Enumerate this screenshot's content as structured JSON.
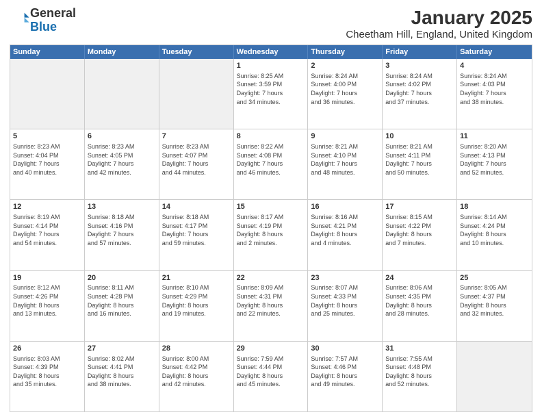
{
  "logo": {
    "general": "General",
    "blue": "Blue"
  },
  "title": "January 2025",
  "subtitle": "Cheetham Hill, England, United Kingdom",
  "days": [
    "Sunday",
    "Monday",
    "Tuesday",
    "Wednesday",
    "Thursday",
    "Friday",
    "Saturday"
  ],
  "weeks": [
    [
      {
        "day": "",
        "info": ""
      },
      {
        "day": "",
        "info": ""
      },
      {
        "day": "",
        "info": ""
      },
      {
        "day": "1",
        "info": "Sunrise: 8:25 AM\nSunset: 3:59 PM\nDaylight: 7 hours\nand 34 minutes."
      },
      {
        "day": "2",
        "info": "Sunrise: 8:24 AM\nSunset: 4:00 PM\nDaylight: 7 hours\nand 36 minutes."
      },
      {
        "day": "3",
        "info": "Sunrise: 8:24 AM\nSunset: 4:02 PM\nDaylight: 7 hours\nand 37 minutes."
      },
      {
        "day": "4",
        "info": "Sunrise: 8:24 AM\nSunset: 4:03 PM\nDaylight: 7 hours\nand 38 minutes."
      }
    ],
    [
      {
        "day": "5",
        "info": "Sunrise: 8:23 AM\nSunset: 4:04 PM\nDaylight: 7 hours\nand 40 minutes."
      },
      {
        "day": "6",
        "info": "Sunrise: 8:23 AM\nSunset: 4:05 PM\nDaylight: 7 hours\nand 42 minutes."
      },
      {
        "day": "7",
        "info": "Sunrise: 8:23 AM\nSunset: 4:07 PM\nDaylight: 7 hours\nand 44 minutes."
      },
      {
        "day": "8",
        "info": "Sunrise: 8:22 AM\nSunset: 4:08 PM\nDaylight: 7 hours\nand 46 minutes."
      },
      {
        "day": "9",
        "info": "Sunrise: 8:21 AM\nSunset: 4:10 PM\nDaylight: 7 hours\nand 48 minutes."
      },
      {
        "day": "10",
        "info": "Sunrise: 8:21 AM\nSunset: 4:11 PM\nDaylight: 7 hours\nand 50 minutes."
      },
      {
        "day": "11",
        "info": "Sunrise: 8:20 AM\nSunset: 4:13 PM\nDaylight: 7 hours\nand 52 minutes."
      }
    ],
    [
      {
        "day": "12",
        "info": "Sunrise: 8:19 AM\nSunset: 4:14 PM\nDaylight: 7 hours\nand 54 minutes."
      },
      {
        "day": "13",
        "info": "Sunrise: 8:18 AM\nSunset: 4:16 PM\nDaylight: 7 hours\nand 57 minutes."
      },
      {
        "day": "14",
        "info": "Sunrise: 8:18 AM\nSunset: 4:17 PM\nDaylight: 7 hours\nand 59 minutes."
      },
      {
        "day": "15",
        "info": "Sunrise: 8:17 AM\nSunset: 4:19 PM\nDaylight: 8 hours\nand 2 minutes."
      },
      {
        "day": "16",
        "info": "Sunrise: 8:16 AM\nSunset: 4:21 PM\nDaylight: 8 hours\nand 4 minutes."
      },
      {
        "day": "17",
        "info": "Sunrise: 8:15 AM\nSunset: 4:22 PM\nDaylight: 8 hours\nand 7 minutes."
      },
      {
        "day": "18",
        "info": "Sunrise: 8:14 AM\nSunset: 4:24 PM\nDaylight: 8 hours\nand 10 minutes."
      }
    ],
    [
      {
        "day": "19",
        "info": "Sunrise: 8:12 AM\nSunset: 4:26 PM\nDaylight: 8 hours\nand 13 minutes."
      },
      {
        "day": "20",
        "info": "Sunrise: 8:11 AM\nSunset: 4:28 PM\nDaylight: 8 hours\nand 16 minutes."
      },
      {
        "day": "21",
        "info": "Sunrise: 8:10 AM\nSunset: 4:29 PM\nDaylight: 8 hours\nand 19 minutes."
      },
      {
        "day": "22",
        "info": "Sunrise: 8:09 AM\nSunset: 4:31 PM\nDaylight: 8 hours\nand 22 minutes."
      },
      {
        "day": "23",
        "info": "Sunrise: 8:07 AM\nSunset: 4:33 PM\nDaylight: 8 hours\nand 25 minutes."
      },
      {
        "day": "24",
        "info": "Sunrise: 8:06 AM\nSunset: 4:35 PM\nDaylight: 8 hours\nand 28 minutes."
      },
      {
        "day": "25",
        "info": "Sunrise: 8:05 AM\nSunset: 4:37 PM\nDaylight: 8 hours\nand 32 minutes."
      }
    ],
    [
      {
        "day": "26",
        "info": "Sunrise: 8:03 AM\nSunset: 4:39 PM\nDaylight: 8 hours\nand 35 minutes."
      },
      {
        "day": "27",
        "info": "Sunrise: 8:02 AM\nSunset: 4:41 PM\nDaylight: 8 hours\nand 38 minutes."
      },
      {
        "day": "28",
        "info": "Sunrise: 8:00 AM\nSunset: 4:42 PM\nDaylight: 8 hours\nand 42 minutes."
      },
      {
        "day": "29",
        "info": "Sunrise: 7:59 AM\nSunset: 4:44 PM\nDaylight: 8 hours\nand 45 minutes."
      },
      {
        "day": "30",
        "info": "Sunrise: 7:57 AM\nSunset: 4:46 PM\nDaylight: 8 hours\nand 49 minutes."
      },
      {
        "day": "31",
        "info": "Sunrise: 7:55 AM\nSunset: 4:48 PM\nDaylight: 8 hours\nand 52 minutes."
      },
      {
        "day": "",
        "info": ""
      }
    ]
  ]
}
